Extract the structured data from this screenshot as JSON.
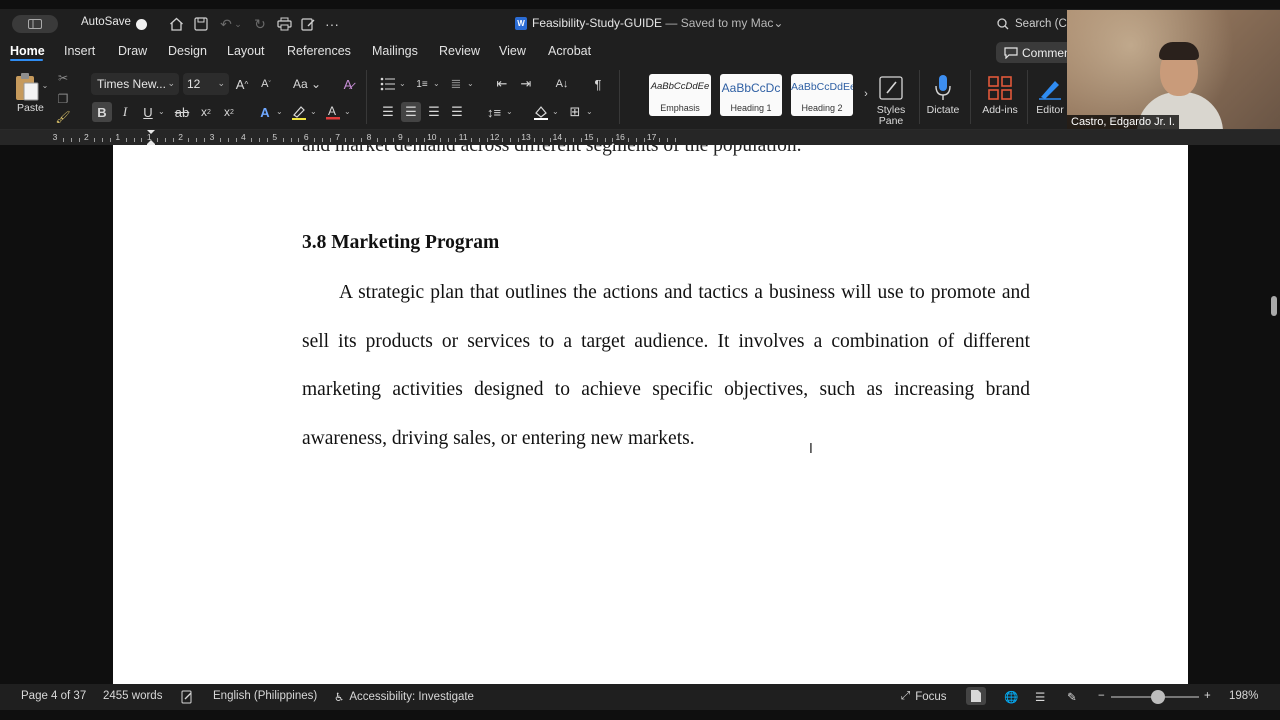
{
  "titlebar": {
    "autosave_label": "AutoSave",
    "doc_name": "Feasibility-Study-GUIDE",
    "saved_status": "— Saved to my Mac",
    "search_placeholder": "Search (C"
  },
  "tabs": [
    {
      "label": "Home"
    },
    {
      "label": "Insert"
    },
    {
      "label": "Draw"
    },
    {
      "label": "Design"
    },
    {
      "label": "Layout"
    },
    {
      "label": "References"
    },
    {
      "label": "Mailings"
    },
    {
      "label": "Review"
    },
    {
      "label": "View"
    },
    {
      "label": "Acrobat"
    }
  ],
  "comments_label": "Commen",
  "ribbon": {
    "paste_label": "Paste",
    "font_name": "Times New...",
    "font_size": "12",
    "styles": [
      {
        "sample": "AaBbCcDdEe",
        "label": "Emphasis"
      },
      {
        "sample": "AaBbCcDc",
        "label": "Heading 1"
      },
      {
        "sample": "AaBbCcDdEe",
        "label": "Heading 2"
      }
    ],
    "styles_pane_label": "Styles Pane",
    "dictate_label": "Dictate",
    "addins_label": "Add-ins",
    "editor_label": "Editor",
    "accent_color": "#2f8cf2"
  },
  "ruler_numbers": [
    "3",
    "2",
    "1",
    "1",
    "2",
    "3",
    "4",
    "5",
    "6",
    "7",
    "8",
    "9",
    "10",
    "11",
    "12",
    "13",
    "14",
    "15",
    "16",
    "17"
  ],
  "document": {
    "prev_line": "and market demand across different segments of the population.",
    "heading": "3.8 Marketing Program",
    "paragraph": "A strategic plan that outlines the actions and tactics a business will use to promote and sell its products or services to a target audience. It involves a combination of different marketing activities designed to achieve specific objectives, such as increasing brand awareness, driving sales, or entering new markets."
  },
  "statusbar": {
    "page": "Page 4 of 37",
    "words": "2455 words",
    "language": "English (Philippines)",
    "accessibility": "Accessibility: Investigate",
    "focus": "Focus",
    "zoom": "198%",
    "zoom_fraction": 0.53
  },
  "webcam": {
    "name": "Castro, Edgardo Jr. I."
  }
}
